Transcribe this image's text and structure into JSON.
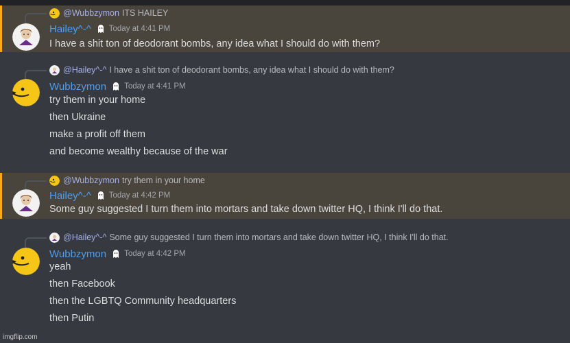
{
  "messages": [
    {
      "reply": {
        "mention": "@Wubbzymon",
        "text": "ITS HAILEY"
      },
      "username": "Hailey^-^",
      "timestamp": "Today at 4:41 PM",
      "lines": [
        "I have a shit ton of deodorant bombs, any idea what I should do with them?"
      ]
    },
    {
      "reply": {
        "mention": "@Hailey^-^",
        "text": "I have a shit ton of deodorant bombs, any idea what I should do with them?"
      },
      "username": "Wubbzymon",
      "timestamp": "Today at 4:41 PM",
      "lines": [
        "try them in your home",
        "then Ukraine",
        "make a profit off them",
        "and become wealthy because of the war"
      ]
    },
    {
      "reply": {
        "mention": "@Wubbzymon",
        "text": "try them in your home"
      },
      "username": "Hailey^-^",
      "timestamp": "Today at 4:42 PM",
      "lines": [
        "Some guy suggested I turn them into mortars and take down twitter HQ, I think I'll do that."
      ]
    },
    {
      "reply": {
        "mention": "@Hailey^-^",
        "text": "Some guy suggested I turn them into mortars and take down twitter HQ, I think I'll do that."
      },
      "username": "Wubbzymon",
      "timestamp": "Today at 4:42 PM",
      "lines": [
        "yeah",
        "then Facebook",
        "then the LGBTQ Community headquarters",
        "then Putin"
      ]
    }
  ],
  "watermark": "imgflip.com",
  "colors": {
    "background": "#36393f",
    "highlight_background": "#49443c",
    "highlight_bar": "#faa81a",
    "username": "#4c9ff0",
    "mention": "#a5b0e8",
    "wubbzymon_avatar": "#f5c518"
  }
}
